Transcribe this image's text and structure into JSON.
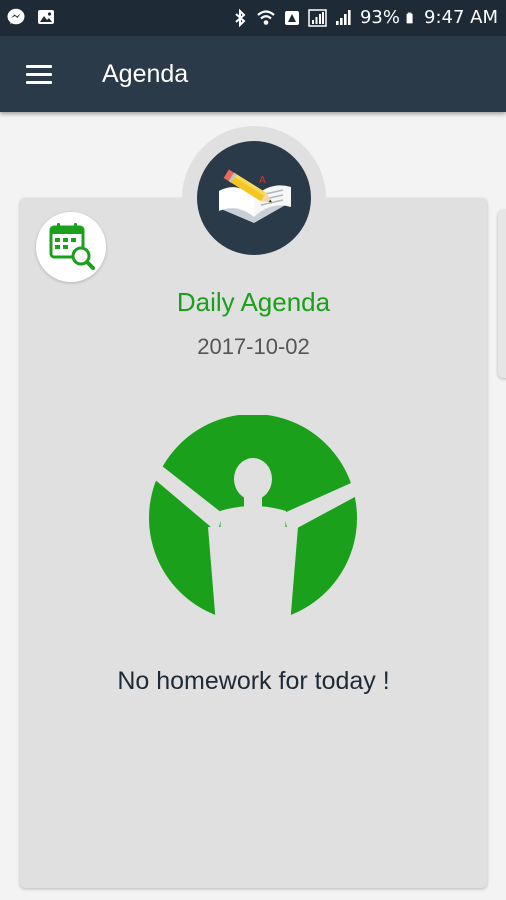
{
  "status_bar": {
    "battery": "93%",
    "time": "9:47 AM",
    "left_icons": [
      "messenger-icon",
      "gallery-icon"
    ],
    "right_icons": [
      "bluetooth-icon",
      "wifi-icon",
      "data-icon",
      "signal-icon",
      "battery-icon"
    ]
  },
  "app_bar": {
    "title": "Agenda",
    "menu_icon": "hamburger-menu-icon"
  },
  "card": {
    "header_icon": "book-pencil-icon",
    "calendar_icon": "calendar-search-icon",
    "title": "Daily Agenda",
    "date": "2017-10-02",
    "illustration_icon": "celebrating-person-icon",
    "empty_message": "No homework for today !"
  },
  "colors": {
    "status_bar": "#1f2a37",
    "app_bar": "#2b3a49",
    "accent_green": "#1aa01a",
    "card_background": "#e0e0e0",
    "page_background": "#f3f3f3"
  }
}
